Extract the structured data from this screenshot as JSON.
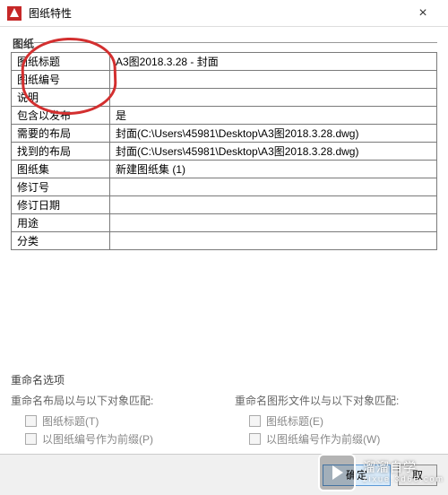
{
  "window": {
    "title": "图纸特性",
    "close_glyph": "×"
  },
  "section1_label": "图纸",
  "rows": [
    {
      "label": "图纸标题",
      "value": "A3图2018.3.28 - 封面"
    },
    {
      "label": "图纸编号",
      "value": ""
    },
    {
      "label": "说明",
      "value": ""
    },
    {
      "label": "包含以发布",
      "value": "是"
    },
    {
      "label": "需要的布局",
      "value": "封面(C:\\Users\\45981\\Desktop\\A3图2018.3.28.dwg)"
    },
    {
      "label": "找到的布局",
      "value": "封面(C:\\Users\\45981\\Desktop\\A3图2018.3.28.dwg)"
    },
    {
      "label": "图纸集",
      "value": "新建图纸集 (1)"
    },
    {
      "label": "修订号",
      "value": ""
    },
    {
      "label": "修订日期",
      "value": ""
    },
    {
      "label": "用途",
      "value": ""
    },
    {
      "label": "分类",
      "value": ""
    }
  ],
  "rename": {
    "title": "重命名选项",
    "left": {
      "label": "重命名布局以与以下对象匹配:",
      "chk1": "图纸标题(T)",
      "chk2": "以图纸编号作为前缀(P)"
    },
    "right": {
      "label": "重命名图形文件以与以下对象匹配:",
      "chk1": "图纸标题(E)",
      "chk2": "以图纸编号作为前缀(W)"
    }
  },
  "buttons": {
    "ok": "确定",
    "cancel": "取"
  },
  "watermark": {
    "line1": "溜溜自学",
    "line2": "zixue.3d66.com"
  }
}
